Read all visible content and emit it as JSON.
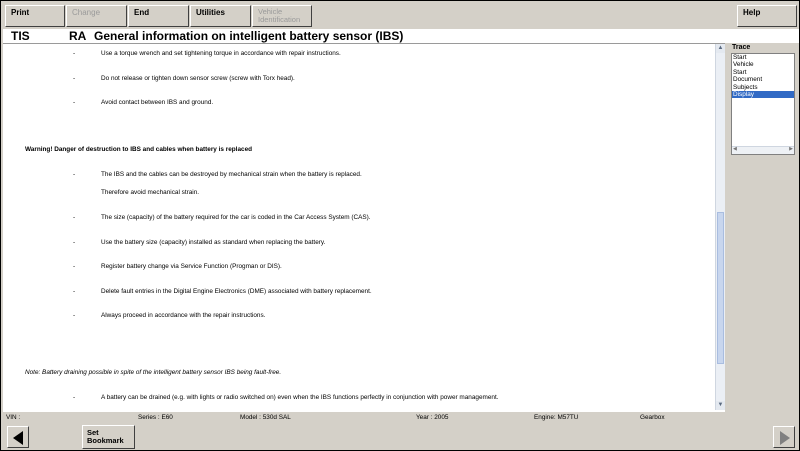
{
  "toolbar": {
    "print": "Print",
    "change": "Change",
    "end": "End",
    "utilities": "Utilities",
    "vehicle_id_line1": "Vehicle",
    "vehicle_id_line2": "Identification",
    "help": "Help"
  },
  "header": {
    "tis": "TIS",
    "ra": "RA",
    "title": "General information on intelligent battery sensor (IBS)"
  },
  "content": {
    "dash": "-",
    "items": [
      "Use a torque wrench and set tightening torque in accordance with repair instructions.",
      "Do not release or tighten down sensor screw (screw with Torx head).",
      "Avoid contact between IBS and ground.",
      "The IBS and the cables can be destroyed by mechanical strain when the battery is replaced.",
      "Therefore avoid mechanical strain.",
      "The size (capacity) of the battery required for the car is coded in the Car Access System (CAS).",
      "Use the battery size (capacity) installed as standard when replacing the battery.",
      "Register battery change via Service Function (Progman or DIS).",
      "Delete fault entries in the Digital Engine Electronics (DME) associated with battery replacement.",
      "Always proceed in accordance with the repair instructions.",
      "A battery can be drained (e.g. with lights or radio switched on) even when the IBS functions perfectly in conjunction with power management."
    ],
    "warning": "Warning! Danger of destruction to IBS and cables when battery is replaced",
    "note": "Note: Battery draining possible in spite of the intelligent battery sensor IBS being fault-free."
  },
  "trace": {
    "label": "Trace",
    "items": [
      "Start",
      "Vehicle",
      "Start",
      "Document",
      "Subjects",
      "Display"
    ]
  },
  "status": {
    "vin": "VIN :",
    "series": "Series : E60",
    "model": "Model : 530d SAL",
    "year": "Year : 2005",
    "engine": "Engine: M57TU",
    "gearbox": "Gearbox"
  },
  "bottom": {
    "bookmark_line1": "Set",
    "bookmark_line2": "Bookmark"
  }
}
